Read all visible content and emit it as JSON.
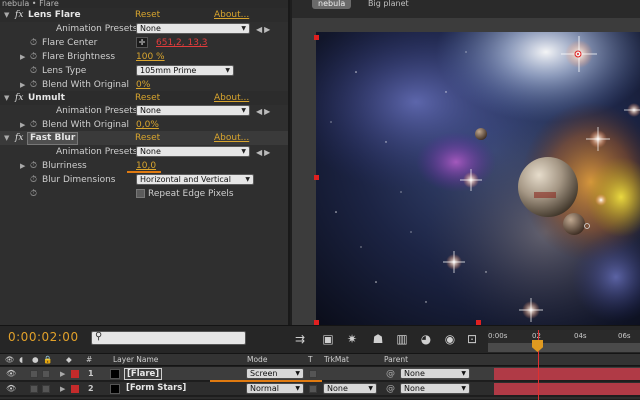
{
  "effects_panel": {
    "title": "nebula • Flare",
    "effects": [
      {
        "name": "Lens Flare",
        "reset": "Reset",
        "about": "About...",
        "rows": [
          {
            "label": "Animation Presets:",
            "value": "None"
          },
          {
            "label": "Flare Center",
            "value": "651,2, 13,3"
          },
          {
            "label": "Flare Brightness",
            "value": "100 %"
          },
          {
            "label": "Lens Type",
            "value": "105mm Prime"
          },
          {
            "label": "Blend With Original",
            "value": "0%"
          }
        ]
      },
      {
        "name": "Unmult",
        "reset": "Reset",
        "about": "About...",
        "rows": [
          {
            "label": "Animation Presets:",
            "value": "None"
          },
          {
            "label": "Blend With Original",
            "value": "0,0%"
          }
        ]
      },
      {
        "name": "Fast Blur",
        "reset": "Reset",
        "about": "About...",
        "rows": [
          {
            "label": "Animation Presets:",
            "value": "None"
          },
          {
            "label": "Blurriness",
            "value": "10,0"
          },
          {
            "label": "Blur Dimensions",
            "value": "Horizontal and Vertical"
          },
          {
            "label": "Repeat Edge Pixels",
            "value": ""
          }
        ]
      }
    ]
  },
  "composition": {
    "tabs": [
      "nebula",
      "Big planet"
    ]
  },
  "timeline": {
    "timecode": "0:00:02:00",
    "search_placeholder": "",
    "ruler_ticks": [
      "0:00s",
      "02",
      "04s",
      "06s"
    ],
    "columns": {
      "hash": "#",
      "layer_name": "Layer Name",
      "mode": "Mode",
      "t": "T",
      "trkmat": "TrkMat",
      "parent": "Parent"
    },
    "layers": [
      {
        "num": "1",
        "name": "[Flare]",
        "mode": "Screen",
        "trkmat": "",
        "parent": "None"
      },
      {
        "num": "2",
        "name": "[Form Stars]",
        "mode": "Normal",
        "trkmat": "None",
        "parent": "None"
      }
    ]
  },
  "colors": {
    "accent_orange": "#d9a52e",
    "timecode_orange": "#e2a12a",
    "layer_label_red": "#c42b2b",
    "layer_bar": "#b03a46",
    "cti_red": "#e03030"
  }
}
